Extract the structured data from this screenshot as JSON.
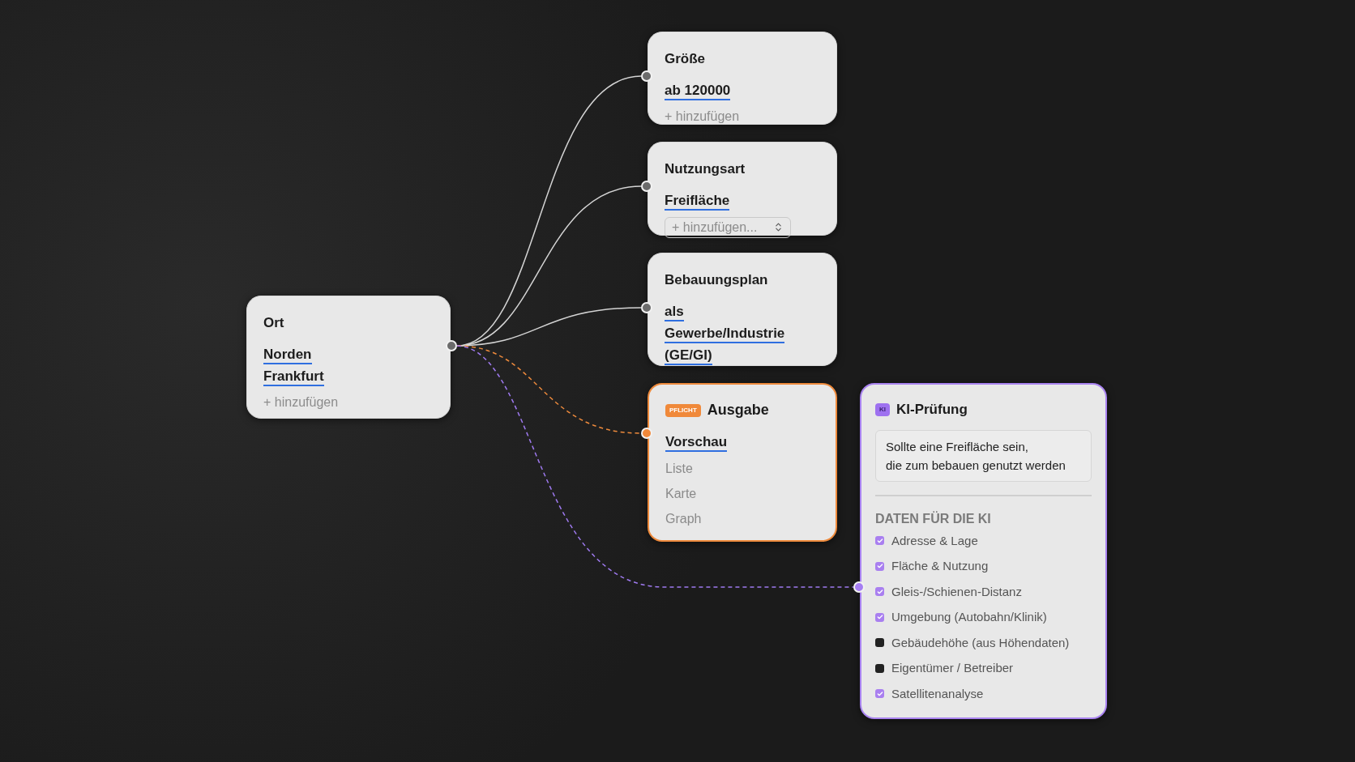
{
  "nodes": [
    {
      "kind": "filter",
      "title": "Ort",
      "values": [
        {
          "label": "Norden"
        },
        {
          "label": "Frankfurt"
        }
      ],
      "add": {
        "kind": "link",
        "label": "+ hinzufügen"
      }
    },
    {
      "kind": "filter",
      "title": "Größe",
      "values": [
        {
          "label": "ab 120000"
        }
      ],
      "add": {
        "kind": "link",
        "label": "+ hinzufügen"
      }
    },
    {
      "kind": "filter",
      "title": "Nutzungsart",
      "values": [
        {
          "label": "Freifläche"
        }
      ],
      "add": {
        "kind": "select",
        "label": "+ hinzufügen..."
      }
    },
    {
      "kind": "filter",
      "title": "Bebauungsplan",
      "values": [
        {
          "label": "als"
        },
        {
          "label": "Gewerbe/Industrie"
        },
        {
          "label": "(GE/GI)"
        }
      ]
    },
    {
      "kind": "output",
      "badge": "PFLICHT",
      "title": "Ausgabe",
      "options": [
        {
          "label": "Vorschau",
          "selected": true
        },
        {
          "label": "Liste",
          "selected": false
        },
        {
          "label": "Karte",
          "selected": false
        },
        {
          "label": "Graph",
          "selected": false
        }
      ]
    },
    {
      "kind": "ai",
      "badge": "KI",
      "title": "KI-Prüfung",
      "prompt": "Sollte eine Freifläche sein,\ndie zum bebauen genutzt werden",
      "section": "DATEN FÜR DIE KI",
      "items": [
        {
          "label": "Adresse & Lage",
          "checked": true
        },
        {
          "label": "Fläche & Nutzung",
          "checked": true
        },
        {
          "label": "Gleis-/Schienen-Distanz",
          "checked": true
        },
        {
          "label": "Umgebung (Autobahn/Klinik)",
          "checked": true
        },
        {
          "label": "Gebäudehöhe (aus Höhendaten)",
          "checked": false
        },
        {
          "label": "Eigentümer / Betreiber",
          "checked": false
        },
        {
          "label": "Satellitenanalyse",
          "checked": true
        }
      ]
    }
  ]
}
